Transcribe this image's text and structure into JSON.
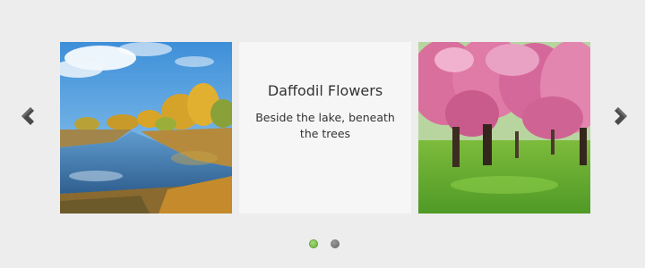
{
  "carousel": {
    "prev_icon": "chevron-left-icon",
    "next_icon": "chevron-right-icon",
    "slides": [
      {
        "kind": "image",
        "subject": "lake-autumn-trees"
      },
      {
        "kind": "caption",
        "title": "Daffodil Flowers",
        "text": "Beside the lake, beneath the trees"
      },
      {
        "kind": "image",
        "subject": "cherry-blossom-trees"
      }
    ],
    "pager": {
      "count": 2,
      "active_index": 0,
      "active_color": "#7cc04f",
      "inactive_color": "#777777"
    }
  }
}
